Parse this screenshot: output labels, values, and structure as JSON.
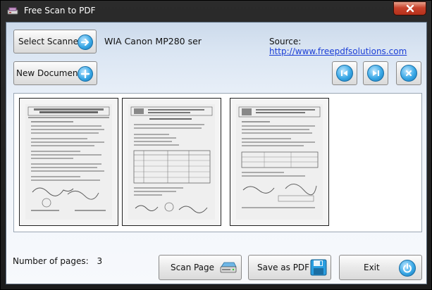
{
  "window": {
    "title": "Free Scan to PDF"
  },
  "toolbar": {
    "select_scanner_label": "Select Scanner",
    "scanner_name": "WIA Canon MP280 ser",
    "new_document_label": "New Document",
    "source_label": "Source:",
    "source_url": "http://www.freepdfsolutions.com"
  },
  "status": {
    "pages_label": "Number of pages:",
    "pages_count": "3"
  },
  "actions": {
    "scan_page_label": "Scan Page",
    "save_pdf_label": "Save as PDF",
    "exit_label": "Exit"
  },
  "colors": {
    "accent_blue": "#2a9ee0",
    "link": "#1a3dd6",
    "close_red": "#c7432c"
  },
  "icons": [
    "app-scanner-icon",
    "close-icon",
    "arrow-right-icon",
    "plus-icon",
    "first-page-icon",
    "last-page-icon",
    "delete-icon",
    "scanner-icon",
    "floppy-disk-icon",
    "power-icon"
  ]
}
